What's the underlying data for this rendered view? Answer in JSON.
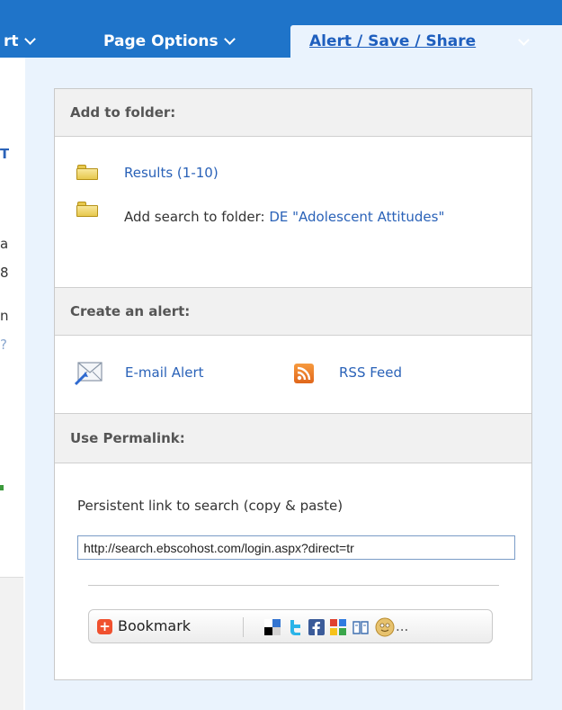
{
  "nav": {
    "export_label": "rt",
    "page_options_label": "Page Options",
    "alert_tab_label": "Alert / Save / Share"
  },
  "left_remnants": [
    "T",
    "a",
    "8",
    "n",
    "?"
  ],
  "panel": {
    "add_to_folder": {
      "heading": "Add to folder:",
      "results_link": "Results (1-10)",
      "add_search_prefix": "Add search to folder: ",
      "add_search_link": "DE \"Adolescent Attitudes\""
    },
    "create_alert": {
      "heading": "Create an alert:",
      "email_alert": "E-mail Alert",
      "rss_feed": "RSS Feed"
    },
    "permalink": {
      "heading": "Use Permalink:",
      "label": "Persistent link to search (copy & paste)",
      "value": "http://search.ebscohost.com/login.aspx?direct=tr"
    },
    "bookmark": {
      "plus": "+",
      "label": "Bookmark",
      "more": "...",
      "icons": [
        "delicious-icon",
        "twitter-icon",
        "facebook-icon",
        "google-icon",
        "book-icon",
        "smiley-icon"
      ]
    }
  },
  "colors": {
    "nav_blue": "#1f74c9",
    "panel_bg": "#eaf3fd",
    "link_blue": "#2a62b8",
    "rss_orange": "#e0661b"
  }
}
